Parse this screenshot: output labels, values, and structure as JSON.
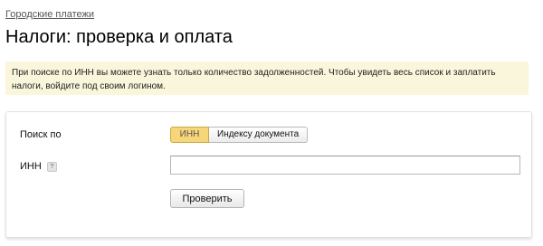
{
  "breadcrumb": {
    "label": "Городские платежи"
  },
  "page": {
    "title": "Налоги: проверка и оплата"
  },
  "notice": {
    "text": "При поиске по ИНН вы можете узнать только количество задолженностей. Чтобы увидеть весь список и заплатить налоги, войдите под своим логином."
  },
  "form": {
    "search_by_label": "Поиск по",
    "search_options": [
      {
        "label": "ИНН",
        "selected": true
      },
      {
        "label": "Индексу документа",
        "selected": false
      }
    ],
    "inn_label": "ИНН",
    "help_icon_glyph": "?",
    "inn_value": "",
    "check_button": "Проверить"
  },
  "colors": {
    "notice_bg": "#faf6dc",
    "selected_toggle": "#f7d67a"
  }
}
